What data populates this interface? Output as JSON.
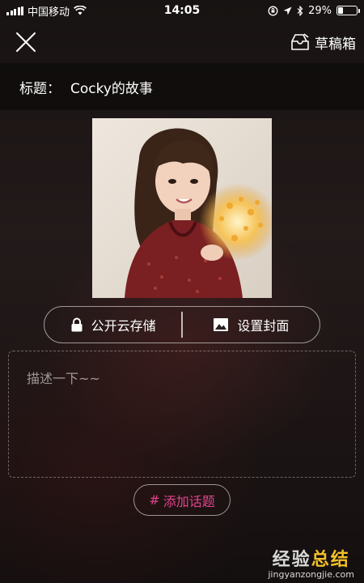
{
  "status_bar": {
    "carrier": "中国移动",
    "time": "14:05",
    "battery": "29%",
    "battery_level": 0.29
  },
  "header": {
    "close_icon": "close-icon",
    "drafts_label": "草稿箱",
    "drafts_icon": "drafts-box-icon"
  },
  "title_bar": {
    "label": "标题：",
    "value": "Cocky的故事"
  },
  "actions": {
    "privacy_label": "公开云存储",
    "privacy_icon": "lock-icon",
    "cover_label": "设置封面",
    "cover_icon": "image-icon"
  },
  "description": {
    "placeholder": "描述一下~~"
  },
  "topic_button": {
    "hash": "#",
    "label": "添加话题",
    "color": "#e0448c"
  },
  "watermark": {
    "main_a": "经验",
    "main_b": "总结",
    "sub": "jingyanzongjie.com"
  }
}
